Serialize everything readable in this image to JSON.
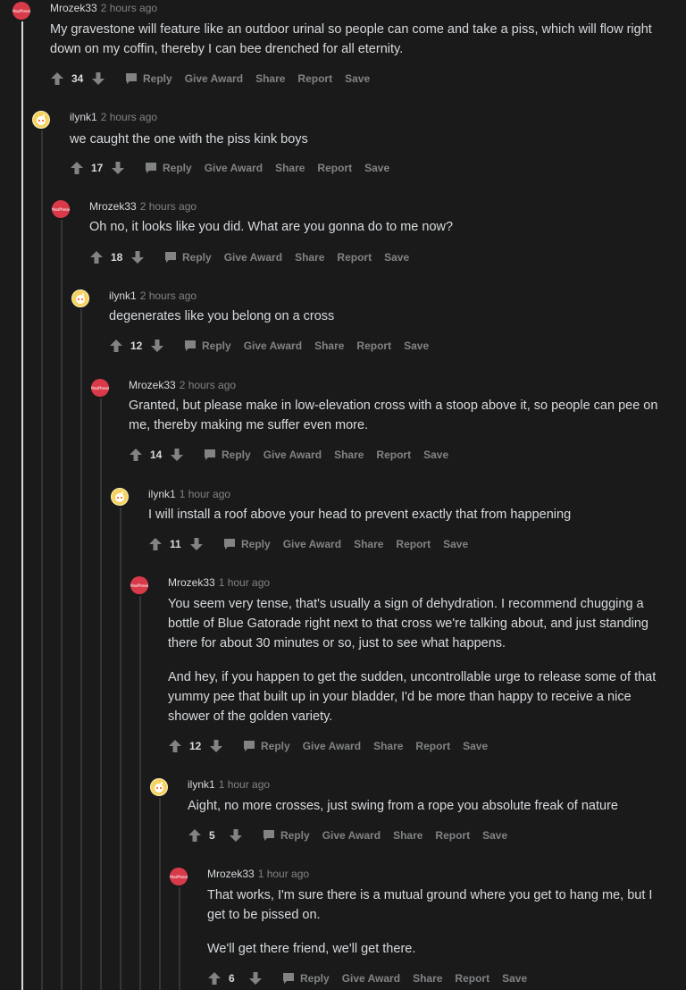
{
  "comments": [
    {
      "author": "Mrozek33",
      "time": "2 hours ago",
      "avatar": "red",
      "paragraphs": [
        "My gravestone will feature like an outdoor urinal so people can come and take a piss, which will flow right down on my coffin, thereby I can bee drenched for all eternity."
      ],
      "score": "34"
    },
    {
      "author": "ilynk1",
      "time": "2 hours ago",
      "avatar": "snoo",
      "paragraphs": [
        "we caught the one with the piss kink boys"
      ],
      "score": "17"
    },
    {
      "author": "Mrozek33",
      "time": "2 hours ago",
      "avatar": "red",
      "paragraphs": [
        "Oh no, it looks like you did. What are you gonna do to me now?"
      ],
      "score": "18"
    },
    {
      "author": "ilynk1",
      "time": "2 hours ago",
      "avatar": "snoo",
      "paragraphs": [
        "degenerates like you belong on a cross"
      ],
      "score": "12"
    },
    {
      "author": "Mrozek33",
      "time": "2 hours ago",
      "avatar": "red",
      "paragraphs": [
        "Granted, but please make in low-elevation cross with a stoop above it, so people can pee on me, thereby making me suffer even more."
      ],
      "score": "14"
    },
    {
      "author": "ilynk1",
      "time": "1 hour ago",
      "avatar": "snoo",
      "paragraphs": [
        "I will install a roof above your head to prevent exactly that from happening"
      ],
      "score": "11"
    },
    {
      "author": "Mrozek33",
      "time": "1 hour ago",
      "avatar": "red",
      "paragraphs": [
        "You seem very tense, that's usually a sign of dehydration. I recommend chugging a bottle of Blue Gatorade right next to that cross we're talking about, and just standing there for about 30 minutes or so, just to see what happens.",
        "And hey, if you happen to get the sudden, uncontrollable urge to release some of that yummy pee that built up in your bladder, I'd be more than happy to receive a nice shower of the golden variety."
      ],
      "score": "12"
    },
    {
      "author": "ilynk1",
      "time": "1 hour ago",
      "avatar": "snoo",
      "paragraphs": [
        "Aight, no more crosses, just swing from a rope you absolute freak of nature"
      ],
      "score": "5"
    },
    {
      "author": "Mrozek33",
      "time": "1 hour ago",
      "avatar": "red",
      "paragraphs": [
        "That works, I'm sure there is a mutual ground where you get to hang me, but I get to be pissed on.",
        "We'll get there friend, we'll get there."
      ],
      "score": "6"
    }
  ],
  "actions": {
    "reply": "Reply",
    "give_award": "Give Award",
    "share": "Share",
    "report": "Report",
    "save": "Save"
  },
  "avatar_label": "MrozPhreak",
  "colors": {
    "background": "#1a1a1b",
    "text": "#d7dadc",
    "muted": "#818384",
    "thread_line": "#343536",
    "avatar_red": "#d93a49"
  }
}
